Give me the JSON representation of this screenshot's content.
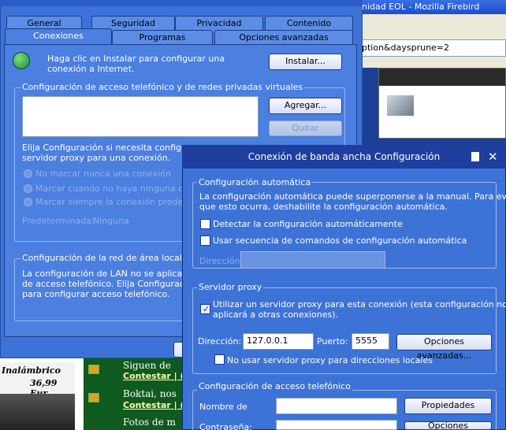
{
  "background": {
    "firebird_title": "nidad EOL - Mozilla Firebird",
    "url_fragment": "ption&daysprune=2",
    "ad_text": "Inalámbrico",
    "ad_price": "36,99 Eur",
    "list": [
      {
        "title": "Siguen de",
        "link": "Contestar | ("
      },
      {
        "title": "Boktai, nos",
        "link": "Contestar | ("
      },
      {
        "title": "Fotos de m",
        "link": ""
      }
    ]
  },
  "props": {
    "tabs_row1": [
      "General",
      "Seguridad",
      "Privacidad",
      "Contenido"
    ],
    "tabs_row2": [
      "Conexiones",
      "Programas",
      "Opciones avanzadas"
    ],
    "install_text": "Haga clic en Instalar para configurar una conexión a Internet.",
    "install_button": "Instalar...",
    "dialup_group": "Configuración de acceso telefónico y de redes privadas virtuales",
    "add_button": "Agregar...",
    "remove_button": "Quitar",
    "choose_text_1": "Elija Configuración si necesita configurar",
    "choose_text_2": "servidor proxy para una conexión.",
    "radio_1": "No marcar nunca una conexión",
    "radio_2": "Marcar cuando no haya ninguna conex",
    "radio_3": "Marcar siempre la conexión predetermin",
    "default_label": "Predeterminada:",
    "default_value": "Ninguna",
    "lan_group": "Configuración de la red de área local (LAN)",
    "lan_text_1": "La configuración de LAN no se aplica a las",
    "lan_text_2": "de acceso telefónico. Elija Configuración, n",
    "lan_text_3": "para configurar acceso telefónico."
  },
  "broadband": {
    "title": "Conexión de banda ancha Configuración",
    "auto_group": "Configuración automática",
    "auto_desc_1": "La configuración automática puede superponerse a la manual. Para evitar",
    "auto_desc_2": "que esto ocurra, deshabilite la configuración automática.",
    "detect_checkbox": "Detectar la configuración automáticamente",
    "script_checkbox": "Usar secuencia de comandos de configuración automática",
    "address_label_dim": "Dirección",
    "proxy_group": "Servidor proxy",
    "proxy_checkbox_1": "Utilizar un servidor proxy para esta conexión (esta configuración no se",
    "proxy_checkbox_2": "aplicará a otras conexiones).",
    "address_label": "Dirección:",
    "address_value": "127.0.0.1",
    "port_label": "Puerto:",
    "port_value": "5555",
    "advanced_button": "Opciones avanzadas...",
    "bypass_checkbox": "No usar servidor proxy para direcciones locales",
    "dialup_group": "Configuración de acceso telefónico",
    "username_label": "Nombre de",
    "password_label": "Contraseña:",
    "properties_button": "Propiedades",
    "advanced_button_2": "Opciones avanzadas..."
  }
}
